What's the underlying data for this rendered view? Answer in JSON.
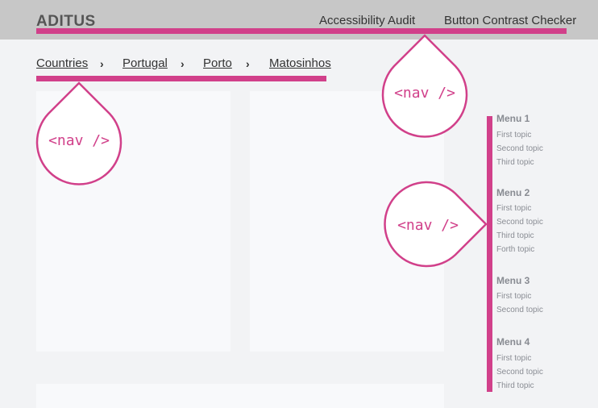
{
  "header": {
    "logo": "ADITUS",
    "nav": [
      "Accessibility Audit",
      "Button Contrast Checker"
    ]
  },
  "breadcrumb": {
    "items": [
      "Countries",
      "Portugal",
      "Porto",
      "Matosinhos"
    ],
    "separator": "›"
  },
  "callouts": [
    "<nav />",
    "<nav />",
    "<nav />"
  ],
  "side_menus": [
    {
      "title": "Menu 1",
      "topics": [
        "First topic",
        "Second topic",
        "Third topic"
      ]
    },
    {
      "title": "Menu 2",
      "topics": [
        "First topic",
        "Second topic",
        "Third topic",
        "Forth topic"
      ]
    },
    {
      "title": "Menu 3",
      "topics": [
        "First topic",
        "Second topic"
      ]
    },
    {
      "title": "Menu 4",
      "topics": [
        "First topic",
        "Second topic",
        "Third topic"
      ]
    }
  ],
  "colors": {
    "accent": "#d1408a",
    "header_bg": "#c7c7c7",
    "page_bg": "#f2f3f5"
  }
}
